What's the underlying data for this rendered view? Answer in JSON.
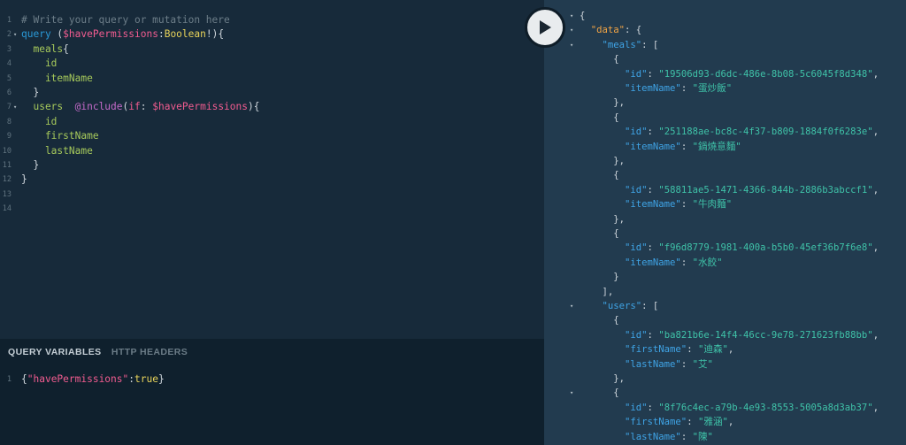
{
  "query_editor": {
    "lines": [
      {
        "n": "1",
        "fold": false,
        "tokens": [
          {
            "t": "# Write your query or mutation here",
            "c": "comment"
          }
        ]
      },
      {
        "n": "2",
        "fold": true,
        "tokens": [
          {
            "t": "query ",
            "c": "kw"
          },
          {
            "t": "(",
            "c": "punct"
          },
          {
            "t": "$havePermissions",
            "c": "var"
          },
          {
            "t": ":",
            "c": "punct"
          },
          {
            "t": "Boolean",
            "c": "type"
          },
          {
            "t": "!){",
            "c": "punct"
          }
        ]
      },
      {
        "n": "3",
        "fold": false,
        "tokens": [
          {
            "t": "  meals",
            "c": "field"
          },
          {
            "t": "{",
            "c": "punct"
          }
        ]
      },
      {
        "n": "4",
        "fold": false,
        "tokens": [
          {
            "t": "    id",
            "c": "field"
          }
        ]
      },
      {
        "n": "5",
        "fold": false,
        "tokens": [
          {
            "t": "    itemName",
            "c": "field"
          }
        ]
      },
      {
        "n": "6",
        "fold": false,
        "tokens": [
          {
            "t": "  }",
            "c": "punct"
          }
        ]
      },
      {
        "n": "7",
        "fold": true,
        "tokens": [
          {
            "t": "  users  ",
            "c": "field"
          },
          {
            "t": "@include",
            "c": "dir"
          },
          {
            "t": "(",
            "c": "punct"
          },
          {
            "t": "if",
            "c": "var"
          },
          {
            "t": ": ",
            "c": "punct"
          },
          {
            "t": "$havePermissions",
            "c": "var"
          },
          {
            "t": "){",
            "c": "punct"
          }
        ]
      },
      {
        "n": "8",
        "fold": false,
        "tokens": [
          {
            "t": "    id",
            "c": "field"
          }
        ]
      },
      {
        "n": "9",
        "fold": false,
        "tokens": [
          {
            "t": "    firstName",
            "c": "field"
          }
        ]
      },
      {
        "n": "10",
        "fold": false,
        "tokens": [
          {
            "t": "    lastName",
            "c": "field"
          }
        ]
      },
      {
        "n": "11",
        "fold": false,
        "tokens": [
          {
            "t": "  }",
            "c": "punct"
          }
        ]
      },
      {
        "n": "12",
        "fold": false,
        "tokens": [
          {
            "t": "}",
            "c": "punct"
          }
        ]
      },
      {
        "n": "13",
        "fold": false,
        "tokens": []
      },
      {
        "n": "14",
        "fold": false,
        "tokens": []
      }
    ]
  },
  "variables_panel": {
    "tab_variables": "QUERY VARIABLES",
    "tab_headers": "HTTP HEADERS",
    "lines": [
      {
        "n": "1",
        "fold": false,
        "tokens": [
          {
            "t": "{",
            "c": "punct"
          },
          {
            "t": "\"havePermissions\"",
            "c": "var"
          },
          {
            "t": ":",
            "c": "punct"
          },
          {
            "t": "true",
            "c": "type"
          },
          {
            "t": "}",
            "c": "punct"
          }
        ]
      }
    ]
  },
  "run_button": {
    "icon": "play-icon"
  },
  "result": {
    "lines": [
      {
        "fold": true,
        "tokens": [
          {
            "t": "{",
            "c": "punct"
          }
        ]
      },
      {
        "fold": true,
        "tokens": [
          {
            "t": "  ",
            "c": "punct"
          },
          {
            "t": "\"data\"",
            "c": "key"
          },
          {
            "t": ": {",
            "c": "punct"
          }
        ]
      },
      {
        "fold": true,
        "tokens": [
          {
            "t": "    ",
            "c": "punct"
          },
          {
            "t": "\"meals\"",
            "c": "rkey"
          },
          {
            "t": ": [",
            "c": "punct"
          }
        ]
      },
      {
        "fold": false,
        "tokens": [
          {
            "t": "      {",
            "c": "punct"
          }
        ]
      },
      {
        "fold": false,
        "tokens": [
          {
            "t": "        ",
            "c": "punct"
          },
          {
            "t": "\"id\"",
            "c": "rkey"
          },
          {
            "t": ": ",
            "c": "punct"
          },
          {
            "t": "\"19506d93-d6dc-486e-8b08-5c6045f8d348\"",
            "c": "str"
          },
          {
            "t": ",",
            "c": "punct"
          }
        ]
      },
      {
        "fold": false,
        "tokens": [
          {
            "t": "        ",
            "c": "punct"
          },
          {
            "t": "\"itemName\"",
            "c": "rkey"
          },
          {
            "t": ": ",
            "c": "punct"
          },
          {
            "t": "\"蛋炒飯\"",
            "c": "str"
          }
        ]
      },
      {
        "fold": false,
        "tokens": [
          {
            "t": "      },",
            "c": "punct"
          }
        ]
      },
      {
        "fold": false,
        "tokens": [
          {
            "t": "      {",
            "c": "punct"
          }
        ]
      },
      {
        "fold": false,
        "tokens": [
          {
            "t": "        ",
            "c": "punct"
          },
          {
            "t": "\"id\"",
            "c": "rkey"
          },
          {
            "t": ": ",
            "c": "punct"
          },
          {
            "t": "\"251188ae-bc8c-4f37-b809-1884f0f6283e\"",
            "c": "str"
          },
          {
            "t": ",",
            "c": "punct"
          }
        ]
      },
      {
        "fold": false,
        "tokens": [
          {
            "t": "        ",
            "c": "punct"
          },
          {
            "t": "\"itemName\"",
            "c": "rkey"
          },
          {
            "t": ": ",
            "c": "punct"
          },
          {
            "t": "\"鍋燒意麵\"",
            "c": "str"
          }
        ]
      },
      {
        "fold": false,
        "tokens": [
          {
            "t": "      },",
            "c": "punct"
          }
        ]
      },
      {
        "fold": false,
        "tokens": [
          {
            "t": "      {",
            "c": "punct"
          }
        ]
      },
      {
        "fold": false,
        "tokens": [
          {
            "t": "        ",
            "c": "punct"
          },
          {
            "t": "\"id\"",
            "c": "rkey"
          },
          {
            "t": ": ",
            "c": "punct"
          },
          {
            "t": "\"58811ae5-1471-4366-844b-2886b3abccf1\"",
            "c": "str"
          },
          {
            "t": ",",
            "c": "punct"
          }
        ]
      },
      {
        "fold": false,
        "tokens": [
          {
            "t": "        ",
            "c": "punct"
          },
          {
            "t": "\"itemName\"",
            "c": "rkey"
          },
          {
            "t": ": ",
            "c": "punct"
          },
          {
            "t": "\"牛肉麵\"",
            "c": "str"
          }
        ]
      },
      {
        "fold": false,
        "tokens": [
          {
            "t": "      },",
            "c": "punct"
          }
        ]
      },
      {
        "fold": false,
        "tokens": [
          {
            "t": "      {",
            "c": "punct"
          }
        ]
      },
      {
        "fold": false,
        "tokens": [
          {
            "t": "        ",
            "c": "punct"
          },
          {
            "t": "\"id\"",
            "c": "rkey"
          },
          {
            "t": ": ",
            "c": "punct"
          },
          {
            "t": "\"f96d8779-1981-400a-b5b0-45ef36b7f6e8\"",
            "c": "str"
          },
          {
            "t": ",",
            "c": "punct"
          }
        ]
      },
      {
        "fold": false,
        "tokens": [
          {
            "t": "        ",
            "c": "punct"
          },
          {
            "t": "\"itemName\"",
            "c": "rkey"
          },
          {
            "t": ": ",
            "c": "punct"
          },
          {
            "t": "\"水餃\"",
            "c": "str"
          }
        ]
      },
      {
        "fold": false,
        "tokens": [
          {
            "t": "      }",
            "c": "punct"
          }
        ]
      },
      {
        "fold": false,
        "tokens": [
          {
            "t": "    ],",
            "c": "punct"
          }
        ]
      },
      {
        "fold": true,
        "tokens": [
          {
            "t": "    ",
            "c": "punct"
          },
          {
            "t": "\"users\"",
            "c": "rkey"
          },
          {
            "t": ": [",
            "c": "punct"
          }
        ]
      },
      {
        "fold": false,
        "tokens": [
          {
            "t": "      {",
            "c": "punct"
          }
        ]
      },
      {
        "fold": false,
        "tokens": [
          {
            "t": "        ",
            "c": "punct"
          },
          {
            "t": "\"id\"",
            "c": "rkey"
          },
          {
            "t": ": ",
            "c": "punct"
          },
          {
            "t": "\"ba821b6e-14f4-46cc-9e78-271623fb88bb\"",
            "c": "str"
          },
          {
            "t": ",",
            "c": "punct"
          }
        ]
      },
      {
        "fold": false,
        "tokens": [
          {
            "t": "        ",
            "c": "punct"
          },
          {
            "t": "\"firstName\"",
            "c": "rkey"
          },
          {
            "t": ": ",
            "c": "punct"
          },
          {
            "t": "\"迪森\"",
            "c": "str"
          },
          {
            "t": ",",
            "c": "punct"
          }
        ]
      },
      {
        "fold": false,
        "tokens": [
          {
            "t": "        ",
            "c": "punct"
          },
          {
            "t": "\"lastName\"",
            "c": "rkey"
          },
          {
            "t": ": ",
            "c": "punct"
          },
          {
            "t": "\"艾\"",
            "c": "str"
          }
        ]
      },
      {
        "fold": false,
        "tokens": [
          {
            "t": "      },",
            "c": "punct"
          }
        ]
      },
      {
        "fold": true,
        "tokens": [
          {
            "t": "      {",
            "c": "punct"
          }
        ]
      },
      {
        "fold": false,
        "tokens": [
          {
            "t": "        ",
            "c": "punct"
          },
          {
            "t": "\"id\"",
            "c": "rkey"
          },
          {
            "t": ": ",
            "c": "punct"
          },
          {
            "t": "\"8f76c4ec-a79b-4e93-8553-5005a8d3ab37\"",
            "c": "str"
          },
          {
            "t": ",",
            "c": "punct"
          }
        ]
      },
      {
        "fold": false,
        "tokens": [
          {
            "t": "        ",
            "c": "punct"
          },
          {
            "t": "\"firstName\"",
            "c": "rkey"
          },
          {
            "t": ": ",
            "c": "punct"
          },
          {
            "t": "\"雅涵\"",
            "c": "str"
          },
          {
            "t": ",",
            "c": "punct"
          }
        ]
      },
      {
        "fold": false,
        "tokens": [
          {
            "t": "        ",
            "c": "punct"
          },
          {
            "t": "\"lastName\"",
            "c": "rkey"
          },
          {
            "t": ": ",
            "c": "punct"
          },
          {
            "t": "\"陳\"",
            "c": "str"
          }
        ]
      }
    ]
  }
}
